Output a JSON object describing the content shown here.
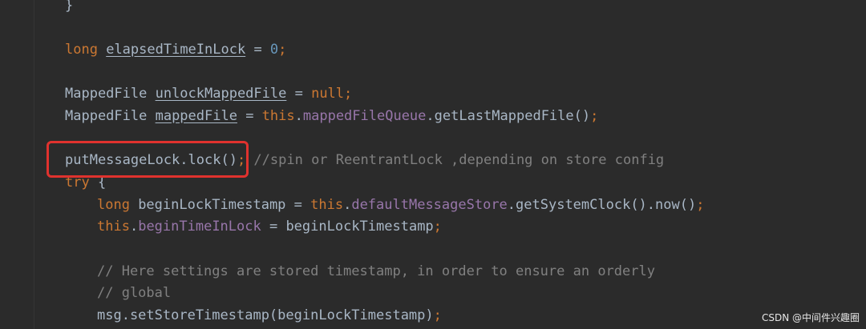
{
  "code": {
    "line1": {
      "brace": "}"
    },
    "line2": {
      "type": "long",
      "name": "elapsedTimeInLock",
      "op": " = ",
      "value": "0",
      "semi": ";"
    },
    "line3": {
      "type": "MappedFile ",
      "name": "unlockMappedFile",
      "op": " = ",
      "value": "null",
      "semi": ";"
    },
    "line4": {
      "type": "MappedFile ",
      "name": "mappedFile",
      "op": " = ",
      "this": "this",
      "dot": ".",
      "field": "mappedFileQueue",
      "call": ".getLastMappedFile()",
      "semi": ";"
    },
    "line5": {
      "code": "putMessageLock.lock()",
      "semi": ";",
      "comment": " //spin or ReentrantLock ,depending on store config"
    },
    "line6": {
      "kw": "try",
      "brace": " {"
    },
    "line7": {
      "type": "long",
      "name": " beginLockTimestamp = ",
      "this": "this",
      "dot": ".",
      "field": "defaultMessageStore",
      "call": ".getSystemClock().now()",
      "semi": ";"
    },
    "line8": {
      "this": "this",
      "dot": ".",
      "field": "beginTimeInLock",
      "rest": " = beginLockTimestamp",
      "semi": ";"
    },
    "line9": {
      "comment": "// Here settings are stored timestamp, in order to ensure an orderly"
    },
    "line10": {
      "comment": "// global"
    },
    "line11": {
      "code": "msg.setStoreTimestamp(beginLockTimestamp)",
      "semi": ";"
    }
  },
  "colors": {
    "background": "#2b2b2b",
    "keyword": "#cc7832",
    "field": "#9876aa",
    "number": "#6897bb",
    "comment": "#808080",
    "text": "#a9b7c6",
    "highlight": "#e0322e"
  },
  "watermark": "CSDN @中间件兴趣圈"
}
